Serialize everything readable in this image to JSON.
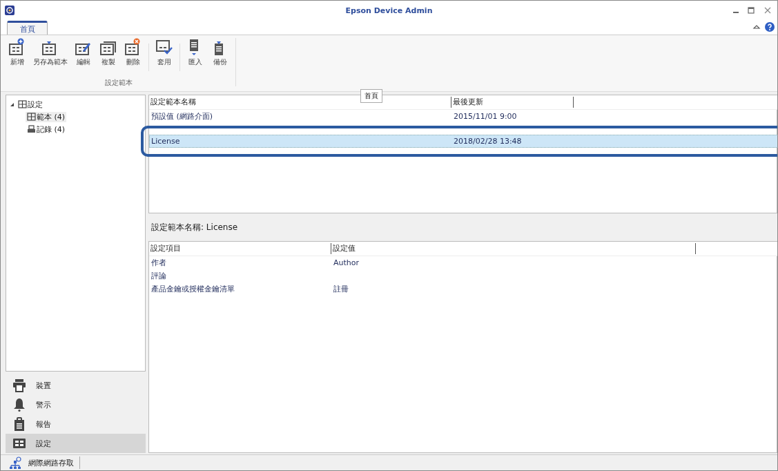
{
  "window": {
    "title": "Epson Device Admin"
  },
  "ribbon": {
    "tabs": [
      {
        "label": "首頁",
        "selected": true
      }
    ],
    "groups": [
      {
        "buttons": [
          {
            "label": "新增",
            "kind": "add"
          },
          {
            "label": "另存為範本",
            "kind": "saveas"
          },
          {
            "label": "編輯",
            "kind": "edit"
          },
          {
            "label": "複製",
            "kind": "copy"
          },
          {
            "label": "刪除",
            "kind": "delete"
          }
        ]
      },
      {
        "buttons": [
          {
            "label": "套用",
            "kind": "apply"
          }
        ]
      },
      {
        "buttons": [
          {
            "label": "匯入",
            "kind": "import"
          },
          {
            "label": "備份",
            "kind": "backup"
          }
        ]
      }
    ],
    "group_label": "設定範本"
  },
  "tooltip": "首頁",
  "tree": [
    {
      "label": "設定",
      "expanded": true,
      "kind": "grid",
      "selected": false,
      "children": [
        {
          "label": "範本 (4)",
          "kind": "grid",
          "selected": true
        },
        {
          "label": "記錄 (4)",
          "kind": "log",
          "selected": false
        }
      ]
    }
  ],
  "nav": [
    {
      "label": "裝置",
      "kind": "printer",
      "selected": false
    },
    {
      "label": "警示",
      "kind": "bell",
      "selected": false
    },
    {
      "label": "報告",
      "kind": "report",
      "selected": false
    },
    {
      "label": "設定",
      "kind": "grid",
      "selected": true
    }
  ],
  "templates": {
    "columns": [
      "設定範本名稱",
      "最後更新"
    ],
    "rows": [
      {
        "name": "預設值 (網路介面)",
        "updated": "2015/11/01 9:00",
        "selected": false
      },
      {
        "name": "License",
        "updated": "2018/02/28 13:48",
        "selected": true
      }
    ]
  },
  "details": {
    "title": "設定範本名稱: License",
    "columns": [
      "設定項目",
      "設定值"
    ],
    "rows": [
      {
        "item": "作者",
        "value": "Author"
      },
      {
        "item": "評論"
      },
      {
        "item": "產品金鑰或授權金鑰清單",
        "value": "註冊"
      }
    ]
  },
  "status_bar": {
    "label": "網際網路存取"
  }
}
